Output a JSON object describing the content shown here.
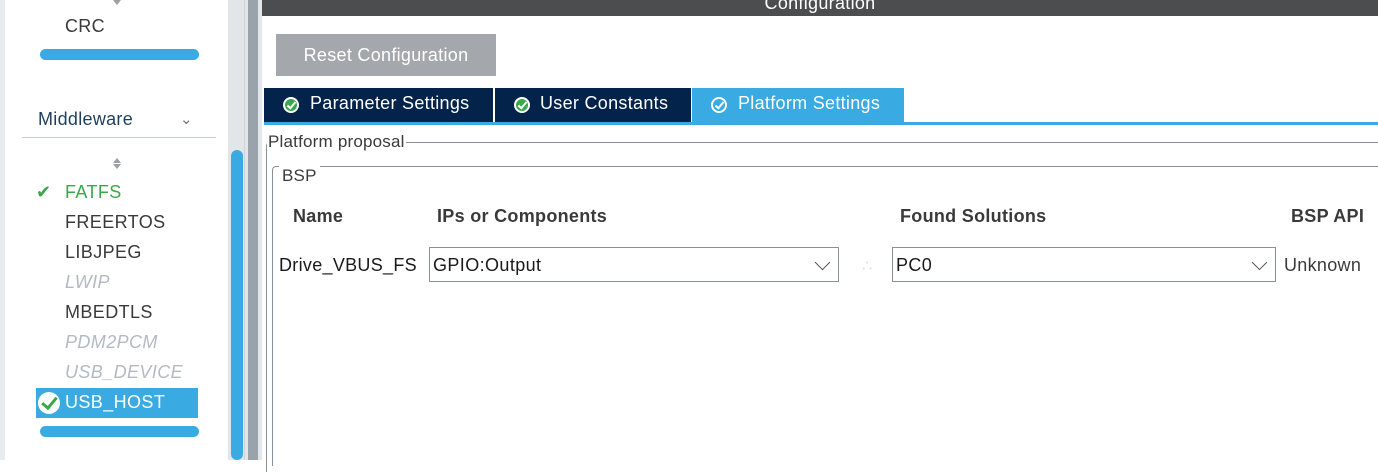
{
  "sidebar": {
    "prev_item": {
      "label": "CRC"
    },
    "middleware": {
      "title": "Middleware",
      "chevron_icon": "chevron-down-icon",
      "items": [
        {
          "label": "FATFS",
          "state": "enabled",
          "icon": "check-icon"
        },
        {
          "label": "FREERTOS",
          "state": "normal"
        },
        {
          "label": "LIBJPEG",
          "state": "normal"
        },
        {
          "label": "LWIP",
          "state": "disabled"
        },
        {
          "label": "MBEDTLS",
          "state": "normal"
        },
        {
          "label": "PDM2PCM",
          "state": "disabled"
        },
        {
          "label": "USB_DEVICE",
          "state": "disabled"
        },
        {
          "label": "USB_HOST",
          "state": "selected",
          "icon": "check-circle-icon"
        }
      ]
    },
    "accent_color": "#3aaae2"
  },
  "main": {
    "title": "Configuration",
    "reset_button": "Reset Configuration",
    "tabs": [
      {
        "label": "Parameter Settings",
        "active": false,
        "icon": "check-circle-icon"
      },
      {
        "label": "User Constants",
        "active": false,
        "icon": "check-circle-icon"
      },
      {
        "label": "Platform Settings",
        "active": true,
        "icon": "check-circle-icon"
      }
    ],
    "platform_proposal": {
      "legend": "Platform proposal",
      "bsp": {
        "legend": "BSP",
        "columns": [
          "Name",
          "IPs or Components",
          "Found Solutions",
          "BSP API"
        ],
        "rows": [
          {
            "name": "Drive_VBUS_FS",
            "ip_component": "GPIO:Output",
            "found_solution": "PC0",
            "bsp_api": "Unknown"
          }
        ]
      }
    },
    "colors": {
      "tab_dark": "#03234b",
      "tab_active": "#3aaae2",
      "titlebar": "#4b4d4f",
      "enabled_green": "#3aa84a"
    }
  }
}
